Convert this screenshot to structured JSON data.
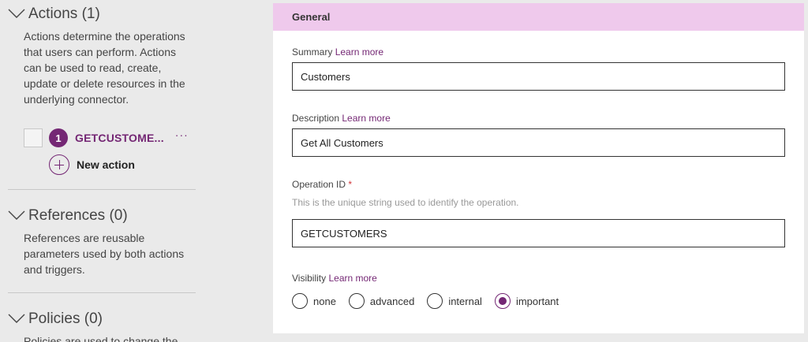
{
  "sidebar": {
    "actions": {
      "title": "Actions (1)",
      "description": "Actions determine the operations that users can perform. Actions can be used to read, create, update or delete resources in the underlying connector.",
      "items": [
        {
          "number": "1",
          "name": "GETCUSTOME...",
          "more": "···"
        }
      ],
      "new_action_label": "New action"
    },
    "references": {
      "title": "References (0)",
      "description": "References are reusable parameters used by both actions and triggers."
    },
    "policies": {
      "title": "Policies (0)",
      "description": "Policies are used to change the"
    }
  },
  "panel": {
    "header": "General",
    "summary": {
      "label": "Summary",
      "link": "Learn more",
      "value": "Customers"
    },
    "description": {
      "label": "Description",
      "link": "Learn more",
      "value": "Get All Customers"
    },
    "operation_id": {
      "label": "Operation ID",
      "required": "*",
      "hint": "This is the unique string used to identify the operation.",
      "value": "GETCUSTOMERS"
    },
    "visibility": {
      "label": "Visibility",
      "link": "Learn more",
      "options": [
        "none",
        "advanced",
        "internal",
        "important"
      ],
      "selected": "important"
    }
  },
  "colors": {
    "accent": "#742774",
    "header_bg": "#efc9ec",
    "page_bg": "#eaeaea"
  },
  "icons": {
    "chevron": "chevron-down-icon",
    "add": "plus-circle-icon"
  }
}
